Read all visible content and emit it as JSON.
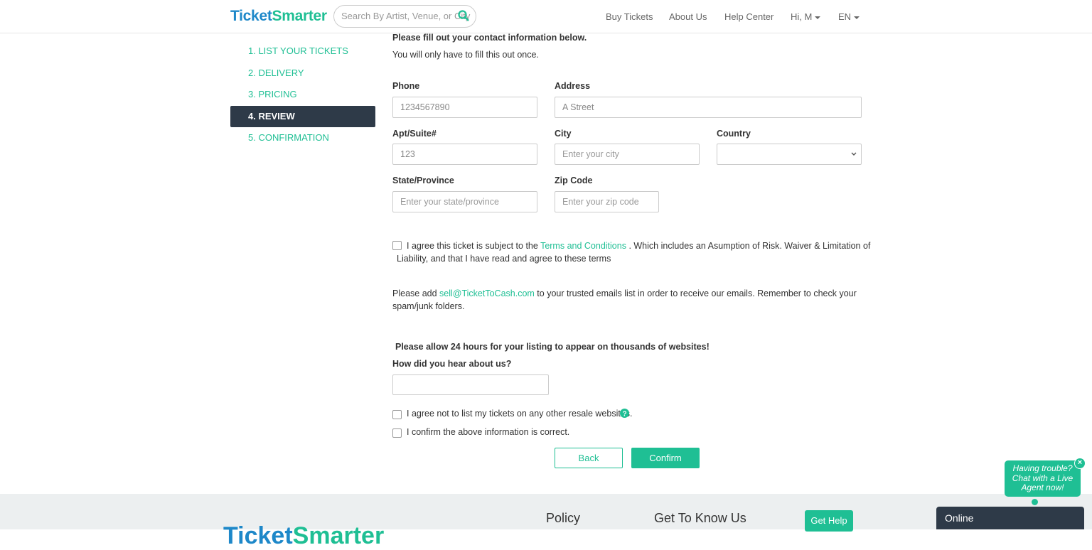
{
  "header": {
    "logo_part1": "Ticket",
    "logo_part2": "Smarter",
    "search_placeholder": "Search By Artist, Venue, or City",
    "nav": [
      "Buy Tickets",
      "About Us",
      "Help Center",
      "Hi, M",
      "EN"
    ]
  },
  "steps": [
    "1. LIST YOUR TICKETS",
    "2. DELIVERY",
    "3. PRICING",
    "4. REVIEW",
    "5. CONFIRMATION"
  ],
  "active_step": 3,
  "form": {
    "intro1": "Please fill out your contact information below.",
    "intro2": "You will only have to fill this out once.",
    "phone_label": "Phone",
    "phone_value": "1234567890",
    "address_label": "Address",
    "address_value": "A Street",
    "apt_label": "Apt/Suite#",
    "apt_value": "123",
    "city_label": "City",
    "city_placeholder": "Enter your city",
    "country_label": "Country",
    "country_value": "",
    "state_label": "State/Province",
    "state_placeholder": "Enter your state/province",
    "zip_label": "Zip Code",
    "zip_placeholder": "Enter your zip code",
    "terms_pre": "I agree this ticket is subject to the ",
    "terms_link": "Terms and Conditions",
    "terms_post": " . Which includes an Asumption of Risk. Waiver & Limitation of",
    "terms_line2": "Liability, and that I have read and agree to these terms",
    "email_pre": "Please add ",
    "email_link": "sell@TicketToCash.com",
    "email_post": " to your trusted emails list in order to receive our emails. Remember to check your",
    "email_line2": "spam/junk folders.",
    "allow_note": "Please allow 24 hours for your listing to appear on thousands of websites!",
    "hear_label": "How did you hear about us?",
    "hear_value": "",
    "agree_resale": "I agree not to list my tickets on any other resale websites.",
    "confirm_info": "I confirm the above information is correct.",
    "back": "Back",
    "confirm": "Confirm"
  },
  "footer": {
    "policy": "Policy",
    "get_to_know": "Get To Know Us",
    "get_help": "Get Help",
    "logo_part1": "Ticket",
    "logo_part2": "Smarter"
  },
  "chat": {
    "bubble": "Having trouble? Chat with a Live Agent now!",
    "status": "Online"
  },
  "colors": {
    "accent": "#1fbf94",
    "brand_blue": "#1e88c9",
    "dark": "#2e3a48"
  }
}
